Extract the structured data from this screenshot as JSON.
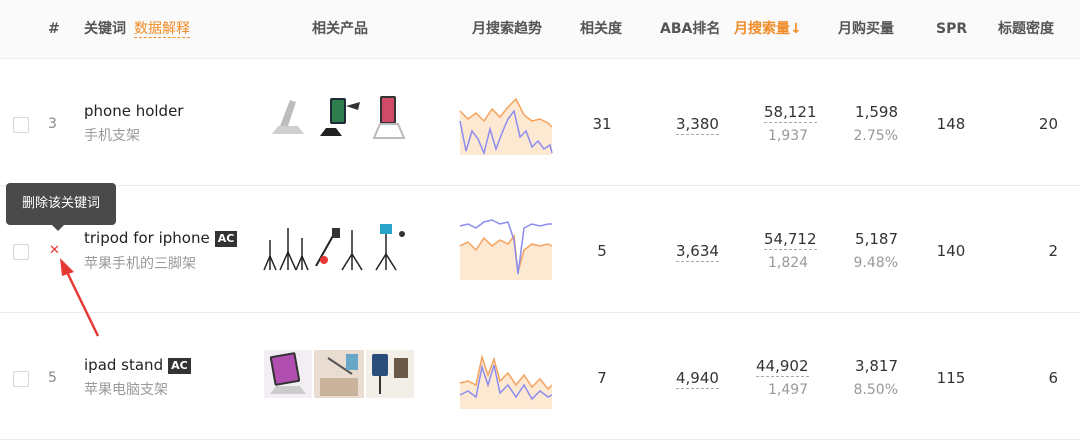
{
  "header": {
    "col_num": "#",
    "col_keyword": "关键词",
    "col_keyword_link": "数据解释",
    "col_products": "相关产品",
    "col_trend": "月搜索趋势",
    "col_relevance": "相关度",
    "col_aba": "ABA排名",
    "col_monthly_search": "月搜索量↓",
    "col_monthly_purchase": "月购买量",
    "col_spr": "SPR",
    "col_title_density": "标题密度"
  },
  "tooltip": "删除该关键词",
  "delete_icon": "close-icon",
  "colors": {
    "accent": "#f08c28",
    "delete": "#e53935",
    "trend_orange": "#f5a25d",
    "trend_purple": "#8c8cf0"
  },
  "rows": [
    {
      "num": "3",
      "keyword": "phone holder",
      "ac": "",
      "keyword_cn": "手机支架",
      "relevance": "31",
      "aba_rank": "3,380",
      "monthly_search": "58,121",
      "monthly_search_sub": "1,937",
      "monthly_purchase": "1,598",
      "purchase_rate": "2.75%",
      "spr": "148",
      "title_density": "20"
    },
    {
      "num": "",
      "keyword": "tripod for iphone",
      "ac": "AC",
      "keyword_cn": "苹果手机的三脚架",
      "relevance": "5",
      "aba_rank": "3,634",
      "monthly_search": "54,712",
      "monthly_search_sub": "1,824",
      "monthly_purchase": "5,187",
      "purchase_rate": "9.48%",
      "spr": "140",
      "title_density": "2"
    },
    {
      "num": "5",
      "keyword": "ipad stand",
      "ac": "AC",
      "keyword_cn": "苹果电脑支架",
      "relevance": "7",
      "aba_rank": "4,940",
      "monthly_search": "44,902",
      "monthly_search_sub": "1,497",
      "monthly_purchase": "3,817",
      "purchase_rate": "8.50%",
      "spr": "115",
      "title_density": "6"
    }
  ]
}
